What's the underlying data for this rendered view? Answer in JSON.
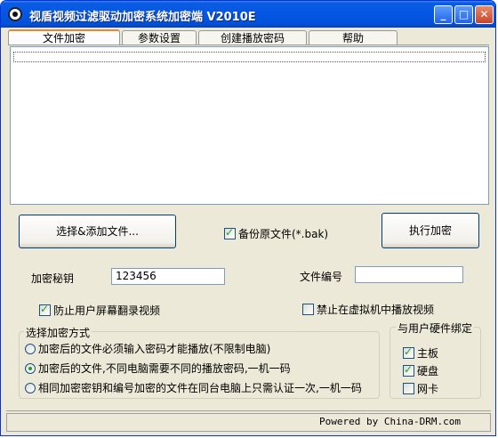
{
  "window": {
    "title": "视盾视频过滤驱动加密系统加密端 V2010E",
    "minimize_glyph": "_",
    "maximize_glyph": "□",
    "close_glyph": "✕"
  },
  "tabs": [
    {
      "label": "文件加密",
      "active": true
    },
    {
      "label": "参数设置",
      "active": false
    },
    {
      "label": "创建播放密码",
      "active": false
    },
    {
      "label": "帮助",
      "active": false
    }
  ],
  "file_list": {
    "items": []
  },
  "buttons": {
    "add_files": "选择&添加文件...",
    "encrypt": "执行加密"
  },
  "backup": {
    "label": "备份原文件(*.bak)",
    "checked": true
  },
  "key": {
    "label": "加密秘钥",
    "value": "123456"
  },
  "file_number": {
    "label": "文件编号",
    "value": ""
  },
  "options": {
    "anti_record": {
      "label": "防止用户屏幕翻录视频",
      "checked": true
    },
    "no_vm": {
      "label": "禁止在虚拟机中播放视频",
      "checked": false
    }
  },
  "method_group": {
    "title": "选择加密方式",
    "choices": [
      {
        "label": "加密后的文件必须输入密码才能播放(不限制电脑)",
        "selected": false
      },
      {
        "label": "加密后的文件,不同电脑需要不同的播放密码,一机一码",
        "selected": true
      },
      {
        "label": "相同加密密钥和编号加密的文件在同台电脑上只需认证一次,一机一码",
        "selected": false
      }
    ]
  },
  "hardware_group": {
    "title": "与用户硬件绑定",
    "items": [
      {
        "label": "主板",
        "checked": true
      },
      {
        "label": "硬盘",
        "checked": true
      },
      {
        "label": "网卡",
        "checked": false
      }
    ]
  },
  "status_bar": {
    "text": "Powered by China-DRM.com"
  }
}
